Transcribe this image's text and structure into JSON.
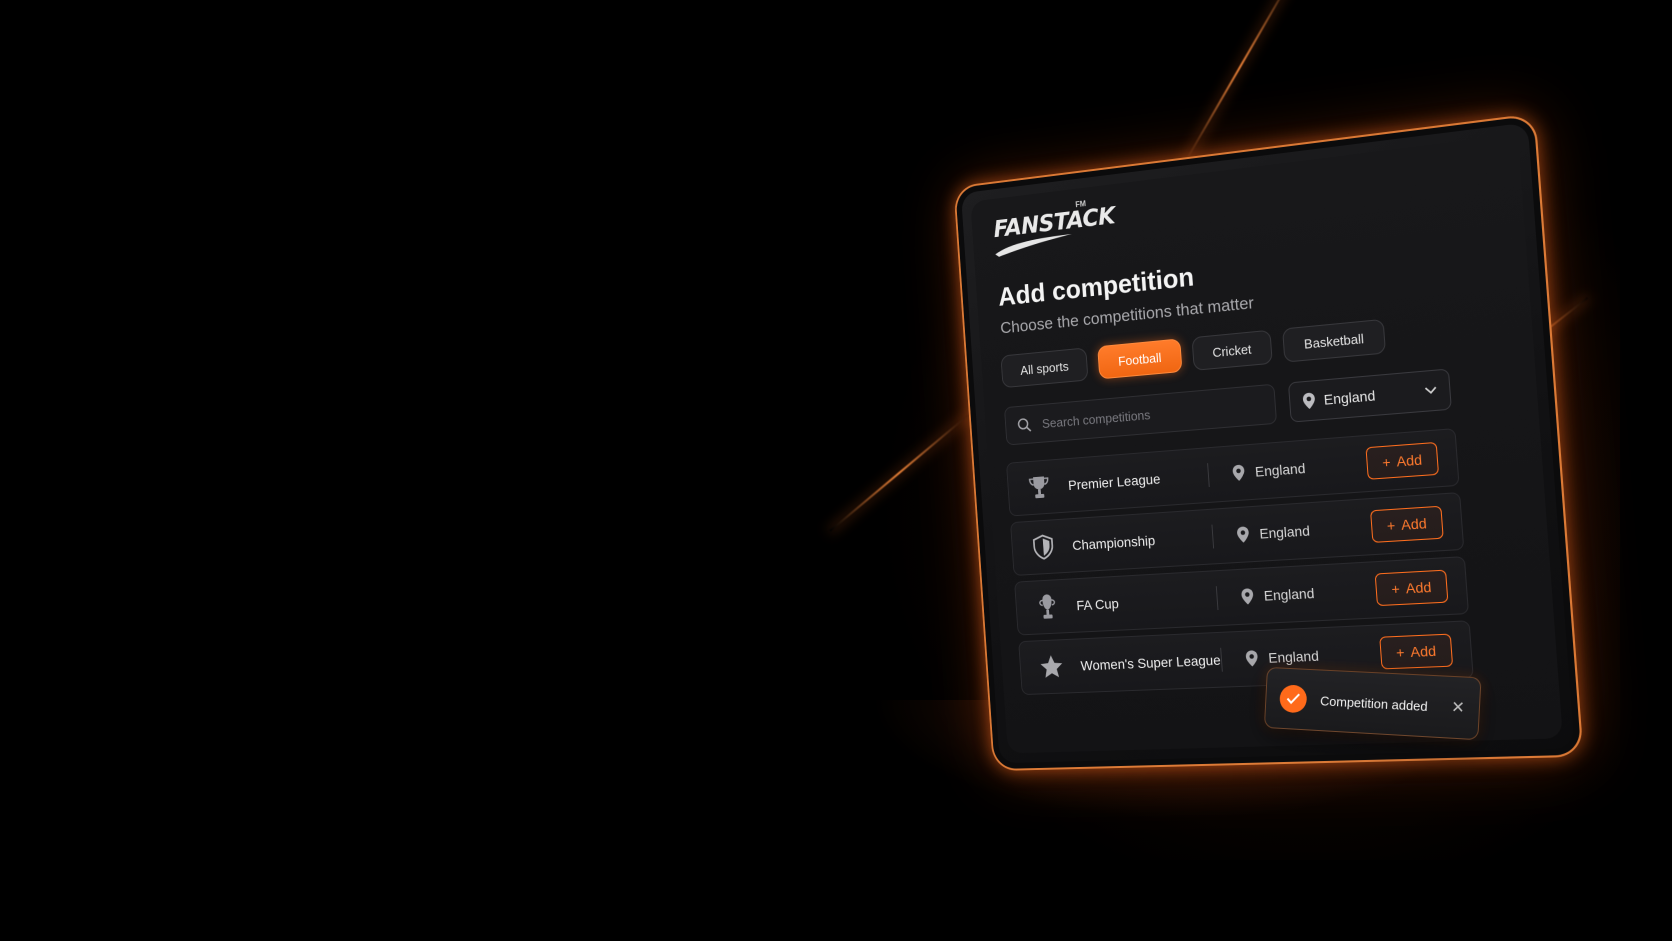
{
  "brand": {
    "name": "FANSTACK",
    "trademark": "FM"
  },
  "header": {
    "title": "Add competition",
    "subtitle": "Choose the competitions that matter"
  },
  "filters": {
    "chips": [
      {
        "label": "All sports",
        "active": false
      },
      {
        "label": "Football",
        "active": true
      },
      {
        "label": "Cricket",
        "active": false
      },
      {
        "label": "Basketball",
        "active": false
      }
    ]
  },
  "search": {
    "placeholder": "Search competitions",
    "value": ""
  },
  "region_select": {
    "selected": "England",
    "icon": "location-pin-icon"
  },
  "competitions": [
    {
      "name": "Premier League",
      "icon": "trophy-icon",
      "location": "England",
      "action": "Add"
    },
    {
      "name": "Championship",
      "icon": "shield-icon",
      "location": "England",
      "action": "Add"
    },
    {
      "name": "FA Cup",
      "icon": "cup-icon",
      "location": "England",
      "action": "Add"
    },
    {
      "name": "Women's Super League",
      "icon": "star-icon",
      "location": "England",
      "action": "Add"
    }
  ],
  "toast": {
    "message": "Competition added",
    "icon": "check-icon"
  },
  "colors": {
    "accent": "#ff6e1e",
    "background": "#000000",
    "surface": "#131315"
  }
}
